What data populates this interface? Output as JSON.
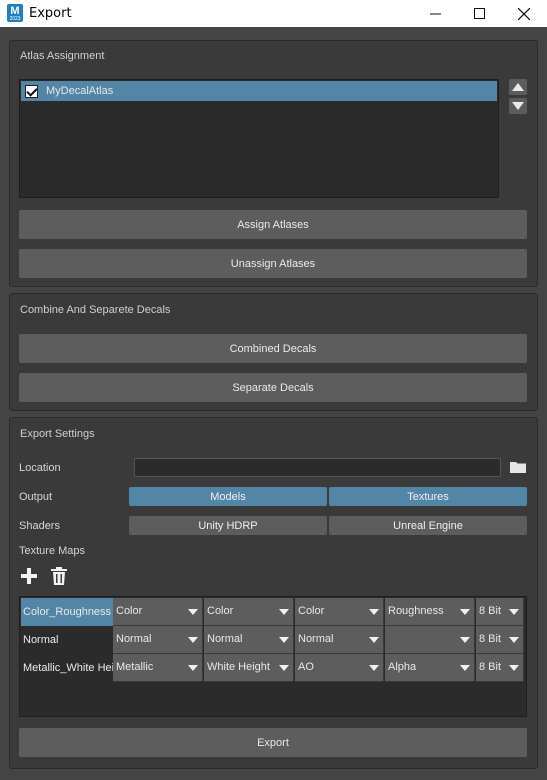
{
  "window": {
    "title": "Export",
    "icon_letter": "M",
    "icon_sub": "2023",
    "minimize_icon": "minimize-icon",
    "maximize_icon": "maximize-icon",
    "close_icon": "close-icon"
  },
  "atlas_assignment": {
    "title": "Atlas Assignment",
    "items": [
      {
        "label": "MyDecalAtlas",
        "checked": true
      }
    ],
    "assign_label": "Assign Atlases",
    "unassign_label": "Unassign Atlases"
  },
  "combine": {
    "title": "Combine And Separete Decals",
    "combined_label": "Combined Decals",
    "separate_label": "Separate Decals"
  },
  "export_settings": {
    "title": "Export Settings",
    "location_label": "Location",
    "location_value": "",
    "output_label": "Output",
    "output_options": [
      "Models",
      "Textures"
    ],
    "shaders_label": "Shaders",
    "shader_options": [
      "Unity HDRP",
      "Unreal Engine"
    ],
    "texture_maps_label": "Texture Maps",
    "texture_maps": [
      {
        "name": "Color_Roughness",
        "r": "Color",
        "g": "Color",
        "b": "Color",
        "a": "Roughness",
        "bits": "8 Bit"
      },
      {
        "name": "Normal",
        "r": "Normal",
        "g": "Normal",
        "b": "Normal",
        "a": "",
        "bits": "8 Bit"
      },
      {
        "name": "Metallic_White Height",
        "r": "Metallic",
        "g": "White Height",
        "b": "AO",
        "a": "Alpha",
        "bits": "8 Bit"
      }
    ],
    "export_label": "Export"
  },
  "colors": {
    "accent": "#5285a6",
    "panel": "#3a3a3a",
    "button": "#5d5d5d"
  }
}
